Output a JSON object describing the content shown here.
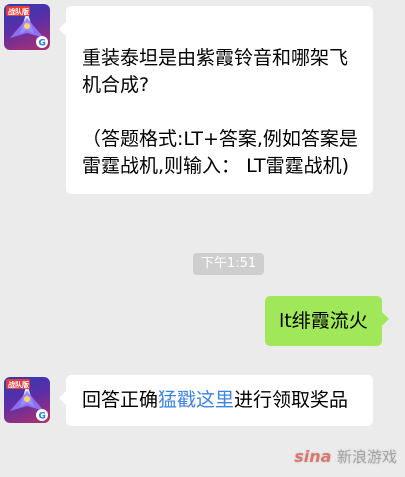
{
  "messages": [
    {
      "sender": "bot",
      "text": "重装泰坦是由紫霞铃音和哪架飞机合成?\n\n（答题格式:LT+答案,例如答案是雷霆战机,则输入：  LT雷霆战机)"
    },
    {
      "timestamp": "下午1:51"
    },
    {
      "sender": "user",
      "text": "lt绯霞流火"
    },
    {
      "sender": "bot",
      "prefix": "回答正确",
      "link": "猛戳这里",
      "suffix": "进行领取奖品"
    }
  ],
  "avatar": {
    "icon": "game-logo-icon",
    "badge_text": "战队版"
  },
  "watermark": {
    "brand": "sina",
    "text": "新浪游戏"
  },
  "colors": {
    "background": "#ebebeb",
    "user_bubble": "#a0e75a",
    "link": "#3d83e3"
  }
}
